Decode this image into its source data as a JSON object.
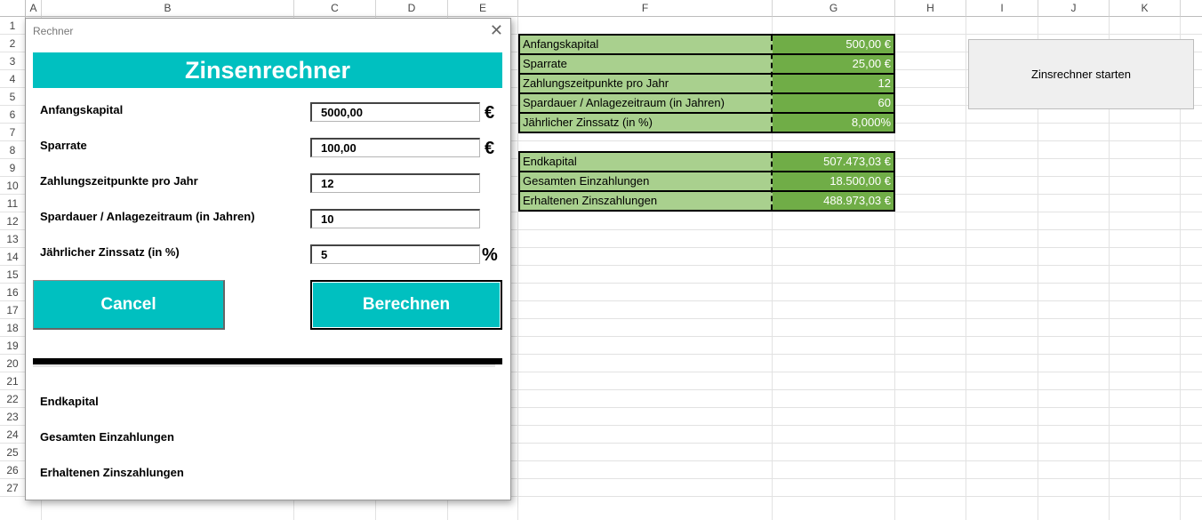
{
  "sheet": {
    "columns": [
      "A",
      "B",
      "C",
      "D",
      "E",
      "F",
      "G",
      "H",
      "I",
      "J",
      "K"
    ],
    "rows": [
      "1",
      "2",
      "3",
      "4",
      "5",
      "6",
      "7",
      "8",
      "9",
      "10",
      "11",
      "12",
      "13",
      "14",
      "15",
      "16",
      "17",
      "18",
      "19",
      "20",
      "21",
      "22",
      "23",
      "24",
      "25",
      "26",
      "27"
    ]
  },
  "input_table": [
    {
      "label": "Anfangskapital",
      "value": "500,00 €"
    },
    {
      "label": "Sparrate",
      "value": "25,00 €"
    },
    {
      "label": "Zahlungszeitpunkte pro Jahr",
      "value": "12"
    },
    {
      "label": "Spardauer / Anlagezeitraum (in Jahren)",
      "value": "60"
    },
    {
      "label": "Jährlicher Zinssatz (in %)",
      "value": "8,000%"
    }
  ],
  "result_table": [
    {
      "label": "Endkapital",
      "value": "507.473,03 €"
    },
    {
      "label": "Gesamten Einzahlungen",
      "value": "18.500,00 €"
    },
    {
      "label": "Erhaltenen Zinszahlungen",
      "value": "488.973,03 €"
    }
  ],
  "sheet_button": {
    "label": "Zinsrechner starten"
  },
  "dialog": {
    "title": "Rechner",
    "close_symbol": "✕",
    "banner": "Zinsenrechner",
    "fields": [
      {
        "label": "Anfangskapital",
        "value": "5000,00",
        "unit": "€"
      },
      {
        "label": "Sparrate",
        "value": "100,00",
        "unit": "€"
      },
      {
        "label": "Zahlungszeitpunkte pro Jahr",
        "value": "12",
        "unit": ""
      },
      {
        "label": "Spardauer / Anlagezeitraum (in Jahren)",
        "value": "10",
        "unit": ""
      },
      {
        "label": "Jährlicher Zinssatz (in %)",
        "value": "5",
        "unit": "%"
      }
    ],
    "cancel_label": "Cancel",
    "calc_label": "Berechnen",
    "results": [
      "Endkapital",
      "Gesamten Einzahlungen",
      "Erhaltenen Zinszahlungen"
    ]
  },
  "colors": {
    "accent": "#00c0c0",
    "label_green": "#a9d08e",
    "value_green": "#70ad47"
  }
}
